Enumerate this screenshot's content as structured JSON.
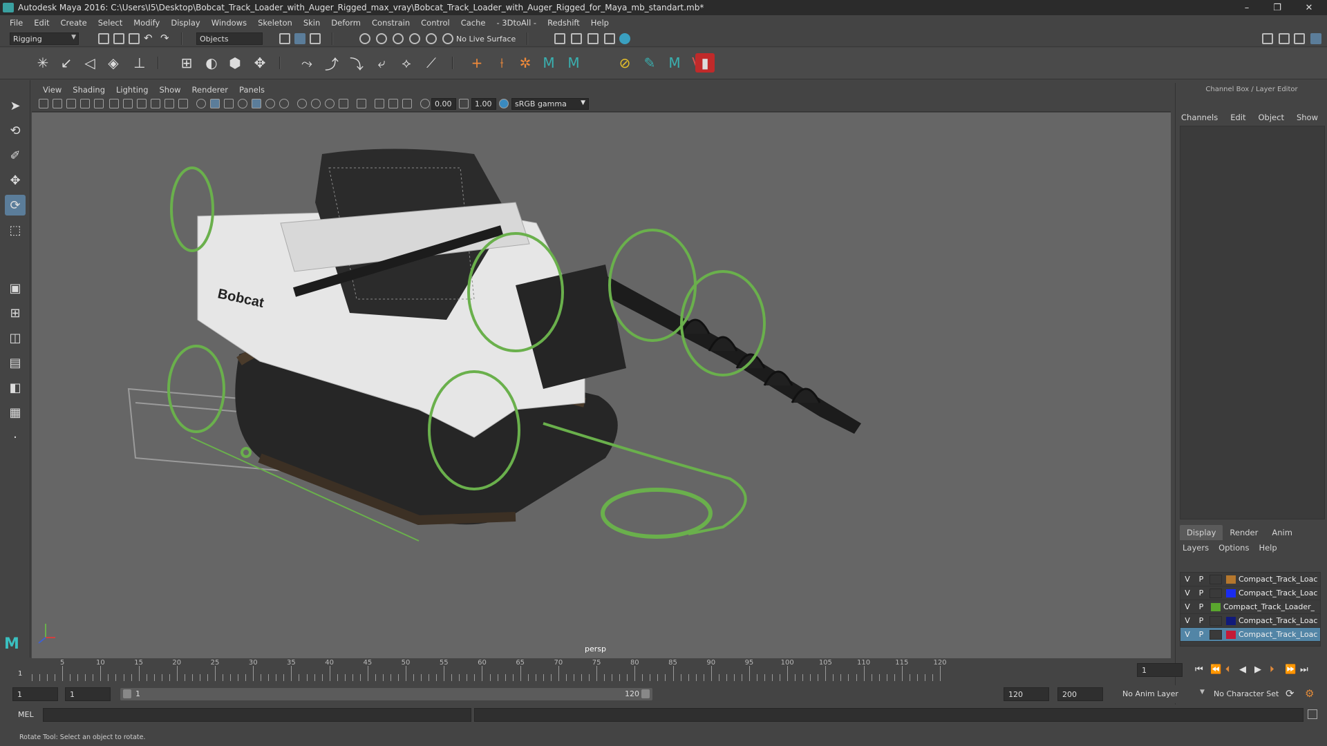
{
  "window": {
    "title": "Autodesk Maya 2016: C:\\Users\\I5\\Desktop\\Bobcat_Track_Loader_with_Auger_Rigged_max_vray\\Bobcat_Track_Loader_with_Auger_Rigged_for_Maya_mb_standart.mb*",
    "minimize": "–",
    "maximize": "❐",
    "close": "✕"
  },
  "menubar": [
    "File",
    "Edit",
    "Create",
    "Select",
    "Modify",
    "Display",
    "Windows",
    "Skeleton",
    "Skin",
    "Deform",
    "Constrain",
    "Control",
    "Cache",
    "- 3DtoAll -",
    "Redshift",
    "Help"
  ],
  "statusline": {
    "menuset": "Rigging",
    "selection_mode": "Objects",
    "live_surface": "No Live Surface"
  },
  "panel": {
    "menu": [
      "View",
      "Shading",
      "Lighting",
      "Show",
      "Renderer",
      "Panels"
    ],
    "exposure": "0.00",
    "gamma": "1.00",
    "color_space": "sRGB gamma",
    "camera": "persp"
  },
  "viewport": {
    "brand_text": "Bobcat",
    "control_color": "#6ab04c",
    "body_color": "#e6e6e6",
    "background": "#666666"
  },
  "channelbox": {
    "header": "Channel Box / Layer Editor",
    "tabs": [
      "Channels",
      "Edit",
      "Object",
      "Show"
    ],
    "layer_tabs": [
      "Display",
      "Render",
      "Anim"
    ],
    "layer_menu": [
      "Layers",
      "Options",
      "Help"
    ],
    "layers": [
      {
        "v": "V",
        "p": "P",
        "color": "#b5772d",
        "name": "Compact_Track_Loac"
      },
      {
        "v": "V",
        "p": "P",
        "color": "#1a2cf0",
        "name": "Compact_Track_Loac"
      },
      {
        "v": "V",
        "p": "P",
        "color": "#5aa62e",
        "name": "Compact_Track_Loader_"
      },
      {
        "v": "V",
        "p": "P",
        "color": "#111a7a",
        "name": "Compact_Track_Loac"
      },
      {
        "v": "V",
        "p": "P",
        "color": "#c41a36",
        "name": "Compact_Track_Loac"
      }
    ]
  },
  "timeslider": {
    "ticks": [
      5,
      10,
      15,
      20,
      25,
      30,
      35,
      40,
      45,
      50,
      55,
      60,
      65,
      70,
      75,
      80,
      85,
      90,
      95,
      100,
      105,
      110,
      115,
      120
    ],
    "start_label": "1",
    "current_frame": "1"
  },
  "range": {
    "start": "1",
    "playback_start": "1",
    "range_start": "1",
    "range_end": "120",
    "playback_end": "120",
    "end": "200",
    "anim_layer": "No Anim Layer",
    "character_set": "No Character Set"
  },
  "commandline": {
    "label": "MEL"
  },
  "helpline": {
    "text": "Rotate Tool: Select an object to rotate."
  }
}
